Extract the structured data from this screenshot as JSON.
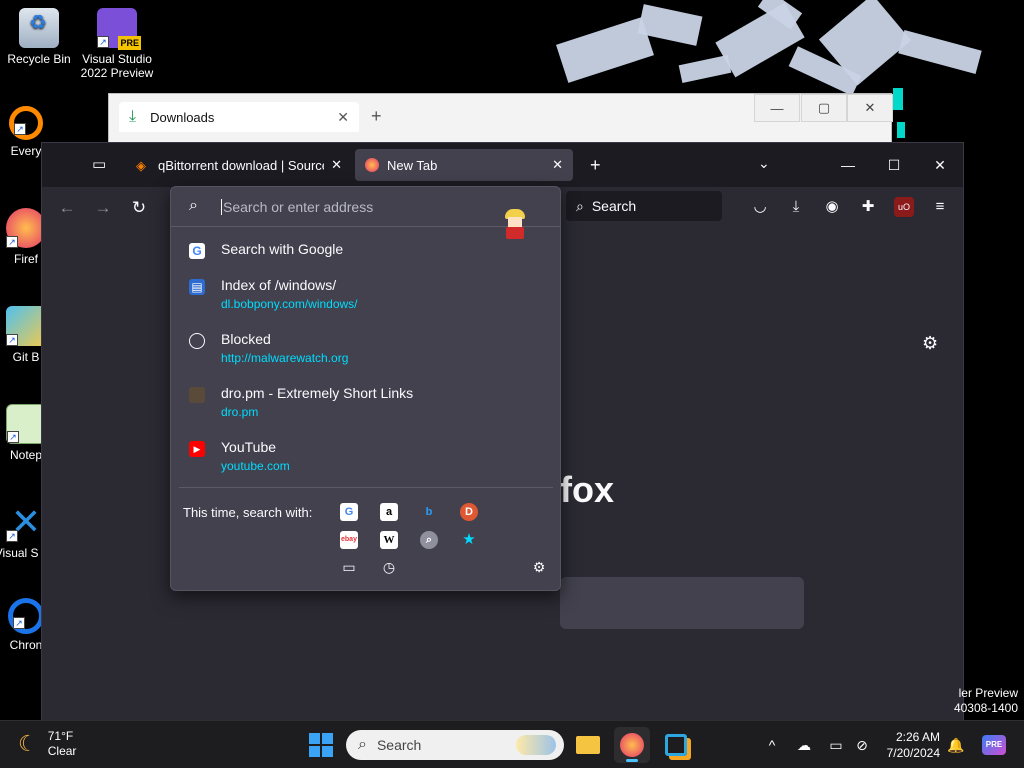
{
  "desktop": {
    "icons": [
      {
        "label": "Recycle Bin"
      },
      {
        "label": "Visual Studio 2022 Preview",
        "badge": "PRE"
      },
      {
        "label": "Every"
      },
      {
        "label": "Firef"
      },
      {
        "label": "Git B"
      },
      {
        "label": "Notep"
      },
      {
        "label": "Visual S Co"
      },
      {
        "label": "Chron"
      }
    ],
    "watermark_line1": "ler Preview",
    "watermark_line2": "40308-1400"
  },
  "downloads_window": {
    "tab_title": "Downloads",
    "close_symbol": "✕",
    "new_tab_symbol": "+",
    "min_symbol": "—",
    "max_symbol": "▢",
    "close_win_symbol": "✕"
  },
  "firefox": {
    "tabs": [
      {
        "title": "qBittorrent download | SourceF",
        "active": false
      },
      {
        "title": "New Tab",
        "active": true
      }
    ],
    "tab_close_symbol": "✕",
    "new_tab_symbol": "+",
    "tab_overflow_symbol": "⌄",
    "window_controls": {
      "minimize": "—",
      "maximize": "☐",
      "close": "✕"
    },
    "nav": {
      "back": "←",
      "forward": "→",
      "reload": "↻"
    },
    "search_box_label": "Search",
    "content_heading_fragment": "fox"
  },
  "urlbar": {
    "placeholder": "Search or enter address",
    "results": [
      {
        "title": "Search with Google",
        "url": "",
        "icon": "google-icon"
      },
      {
        "title": "Index of /windows/",
        "url": "dl.bobpony.com/windows/",
        "icon": "page-icon"
      },
      {
        "title": "Blocked",
        "url": "http://malwarewatch.org",
        "icon": "globe-icon"
      },
      {
        "title": "dro.pm - Extremely Short Links",
        "url": "dro.pm",
        "icon": "dropm-icon"
      },
      {
        "title": "YouTube",
        "url": "youtube.com",
        "icon": "youtube-icon"
      }
    ],
    "oneoff_label": "This time, search with:",
    "engines": [
      {
        "name": "google",
        "glyph": "G",
        "color": "#4285f4",
        "bg": "#ffffff"
      },
      {
        "name": "amazon",
        "glyph": "a",
        "color": "#000000",
        "bg": "#ffffff"
      },
      {
        "name": "bing",
        "glyph": "b",
        "color": "#2b9df5",
        "bg": "transparent"
      },
      {
        "name": "duckduckgo",
        "glyph": "D",
        "color": "#ffffff",
        "bg": "#de5833"
      },
      {
        "name": "ebay",
        "glyph": "ebay",
        "color": "#e53238",
        "bg": "#ffffff"
      },
      {
        "name": "wikipedia",
        "glyph": "W",
        "color": "#000000",
        "bg": "#ffffff"
      },
      {
        "name": "search",
        "glyph": "⌕",
        "color": "#ffffff",
        "bg": "#8f8f9d"
      },
      {
        "name": "bookmarks",
        "glyph": "★",
        "color": "#00ddff",
        "bg": "transparent"
      }
    ]
  },
  "taskbar": {
    "weather_temp": "71°F",
    "weather_desc": "Clear",
    "search_label": "Search",
    "time": "2:26 AM",
    "date": "7/20/2024",
    "tray_up": "^",
    "pre_badge": "PRE"
  }
}
